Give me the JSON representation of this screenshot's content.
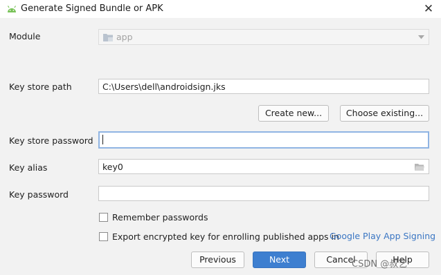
{
  "window": {
    "title": "Generate Signed Bundle or APK",
    "close_glyph": "✕"
  },
  "module": {
    "label": "Module",
    "value": "app"
  },
  "key_store_path": {
    "label": "Key store path",
    "value": "C:\\Users\\dell\\androidsign.jks"
  },
  "buttons": {
    "create_new": "Create new...",
    "choose_existing": "Choose existing...",
    "previous": "Previous",
    "next": "Next",
    "cancel": "Cancel",
    "help": "Help"
  },
  "key_store_password": {
    "label": "Key store password",
    "value": ""
  },
  "key_alias": {
    "label": "Key alias",
    "value": "key0"
  },
  "key_password": {
    "label": "Key password",
    "value": ""
  },
  "remember_passwords": {
    "label": "Remember passwords",
    "checked": false
  },
  "export_key": {
    "label": "Export encrypted key for enrolling published apps in",
    "link": "Google Play App Signing",
    "checked": false
  },
  "watermark": "CSDN @叔艺",
  "colors": {
    "primary_button": "#3e7fd0",
    "link": "#3a76c3",
    "android_green": "#78c257",
    "focus_border": "#8fb4e3"
  }
}
